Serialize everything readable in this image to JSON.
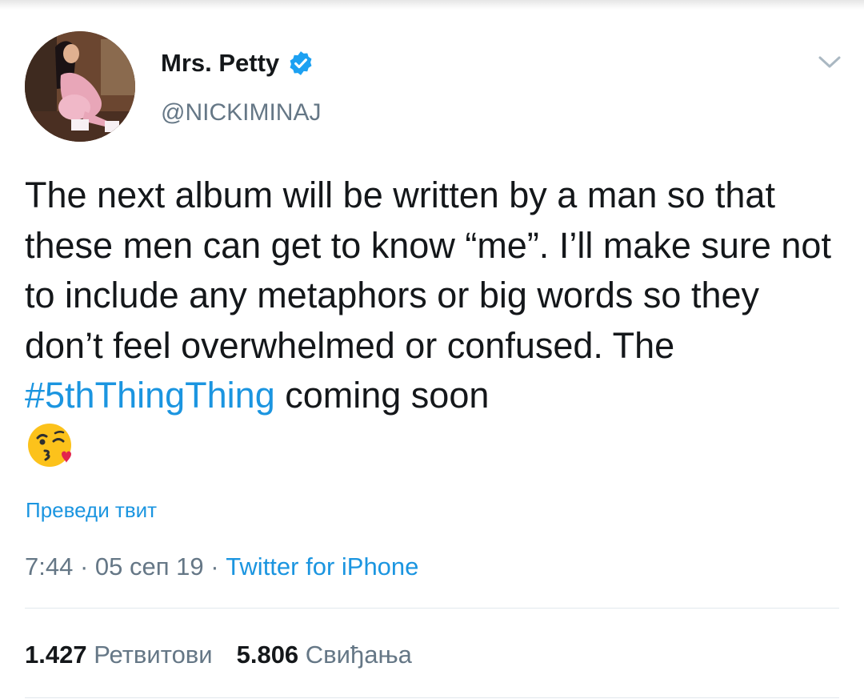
{
  "tweet": {
    "author": {
      "display_name": "Mrs. Petty",
      "handle": "@NICKIMINAJ",
      "verified": true,
      "avatar_icon": "profile-photo"
    },
    "text_before": "The next album will be written by a man so that these men can get to know “me”. I’ll make sure not to include any metaphors or big words so they don’t feel overwhelmed or confused. The ",
    "hashtag": "#5thThingThing",
    "text_after": " coming soon",
    "emoji": "😘",
    "translate_label": "Преведи твит",
    "time": "7:44",
    "separator": " · ",
    "date": "05 сеп 19",
    "source": "Twitter for iPhone",
    "stats": {
      "retweets_count": "1.427",
      "retweets_label": "Ретвитови",
      "likes_count": "5.806",
      "likes_label": "Свиђања"
    }
  },
  "icons": {
    "verified_badge": "verified-badge-icon",
    "menu_caret": "chevron-down-icon"
  },
  "colors": {
    "link": "#1b95e0",
    "secondary_text": "#657786",
    "primary_text": "#14171a",
    "divider": "#e1e8ed"
  }
}
